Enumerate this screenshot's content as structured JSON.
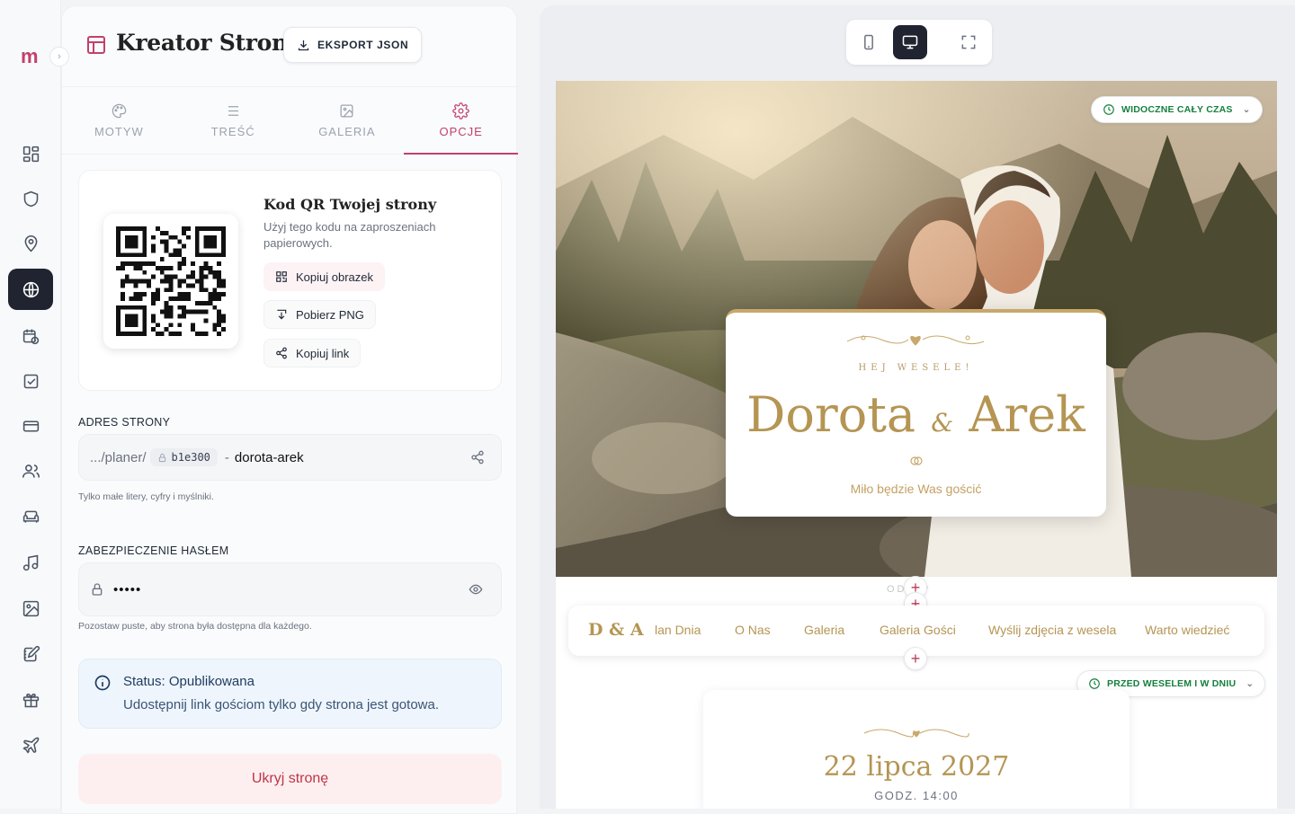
{
  "rail": {
    "logo": "m",
    "items": [
      "dashboard",
      "shield",
      "location",
      "website",
      "calendar",
      "checklist",
      "payments",
      "guests",
      "seating",
      "music",
      "gallery",
      "notes",
      "gifts",
      "travel"
    ]
  },
  "panel": {
    "title": "Kreator Strony",
    "export_label": "EKSPORT JSON",
    "tabs": [
      {
        "label": "MOTYW",
        "icon": "palette-icon"
      },
      {
        "label": "TREŚĆ",
        "icon": "menu-lines-icon"
      },
      {
        "label": "GALERIA",
        "icon": "image-icon"
      },
      {
        "label": "OPCJE",
        "icon": "gear-icon"
      }
    ],
    "qr": {
      "title": "Kod QR Twojej strony",
      "description": "Użyj tego kodu na zaproszeniach papierowych.",
      "copy_image": "Kopiuj obrazek",
      "download_png": "Pobierz PNG",
      "copy_link": "Kopiuj link"
    },
    "address": {
      "label": "ADRES STRONY",
      "prefix": ".../planer/",
      "id": "b1e300",
      "separator": "-",
      "slug": "dorota-arek",
      "hint": "Tylko małe litery, cyfry i myślniki."
    },
    "password": {
      "label": "ZABEZPIECZENIE HASŁEM",
      "value": "•••••",
      "hint": "Pozostaw puste, aby strona była dostępna dla każdego."
    },
    "status": {
      "title": "Status: Opublikowana",
      "text": "Udostępnij link gościom tylko gdy strona jest gotowa."
    },
    "hide_label": "Ukryj stronę"
  },
  "preview": {
    "devices": [
      "mobile",
      "desktop",
      "fullscreen"
    ],
    "active_device": "desktop",
    "hero_badge": "WIDOCZNE CAŁY CZAS",
    "card": {
      "greeting": "HEJ WESELE!",
      "name1": "Dorota",
      "amp": "&",
      "name2": "Arek",
      "subtitle": "Miło będzie Was gościć"
    },
    "countdown_partial": "OD    EP",
    "nav": {
      "logo": "D & A",
      "items": [
        "lan Dnia",
        "O Nas",
        "Galeria",
        "Galeria Gości",
        "Wyślij zdjęcia z wesela",
        "Warto wiedzieć"
      ]
    },
    "section_badge": "PRZED WESELEM I W DNIU",
    "date": "22 lipca 2027",
    "time": "GODZ. 14:00"
  },
  "colors": {
    "accent": "#c2416a",
    "gold": "#b59553",
    "dark": "#1f2430",
    "green": "#15803d"
  }
}
